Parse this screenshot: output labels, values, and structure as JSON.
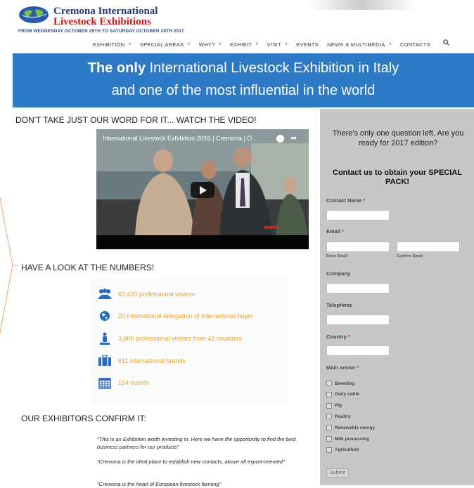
{
  "header": {
    "logo_line1": "Cremona International",
    "logo_line2": "Livestock Exhibitions",
    "dates": "FROM WEDNESDAY OCTOBER 25TH TO SATURDAY OCTOBER 28TH 2017"
  },
  "nav": {
    "items": [
      {
        "label": "EXHIBITION",
        "dropdown": true
      },
      {
        "label": "SPECIAL AREAS",
        "dropdown": true
      },
      {
        "label": "WHY?",
        "dropdown": true
      },
      {
        "label": "EXHIBIT",
        "dropdown": true
      },
      {
        "label": "VISIT",
        "dropdown": true
      },
      {
        "label": "EVENTS",
        "dropdown": false
      },
      {
        "label": "NEWS & MULTIMEDIA",
        "dropdown": true
      },
      {
        "label": "CONTACTS",
        "dropdown": false
      }
    ],
    "chevron": "˅",
    "search_icon": "search-icon"
  },
  "banner": {
    "line1_bold": "The only",
    "line1_rest": " International Livestock Exhibition in Italy",
    "line2": "and one of the most influential in the world",
    "color": "#2c79c6"
  },
  "video_section": {
    "heading": "DON'T TAKE JUST OUR WORD FOR IT... WATCH THE VIDEO!",
    "video_title": "International Livestock Exhibition 2016 | Cremona | O...",
    "share_glyph": "➦"
  },
  "numbers_section": {
    "heading": "HAVE A LOOK AT THE NUMBERS!",
    "stats": [
      {
        "icon": "people-icon",
        "text": "60,420 professional visitors"
      },
      {
        "icon": "globe-icon",
        "text": "20 international delegation of international buyer"
      },
      {
        "icon": "visitor-icon",
        "text": "3,800 professional visitors from 43 countries"
      },
      {
        "icon": "briefcase-icon",
        "text": "811 international brands"
      },
      {
        "icon": "calendar-icon",
        "text": "104 events"
      }
    ],
    "accent": "#e2a43a"
  },
  "exhibitors_section": {
    "heading": "OUR EXHIBITORS CONFIRM IT:",
    "quotes": [
      "\"This is an Exhibition worth investing in. Here we have the opportunity to find the best business partners for our products\"",
      "\"Cremona is the ideal place to establish new contacts, above all export-oriented\"",
      "\"Cremona is the heart of European livestock farming\""
    ]
  },
  "form": {
    "question": "There's only one question left. Are you ready for 2017 edition?",
    "cta": "Contact us to obtain your SPECIAL PACK!",
    "required_mark": "*",
    "contact_name_label": "Contact Name",
    "email_label": "Email",
    "enter_email": "Enter Email",
    "confirm_email": "Confirm Email",
    "company_label": "Company",
    "telephone_label": "Telephone",
    "country_label": "Country",
    "sector_label": "Main sector",
    "sectors": [
      "Breeding",
      "Dairy cattle",
      "Pig",
      "Poultry",
      "Renewable energy",
      "Milk processing",
      "Agriculture"
    ],
    "submit": "Submit",
    "bg": "#c7c7c7"
  }
}
